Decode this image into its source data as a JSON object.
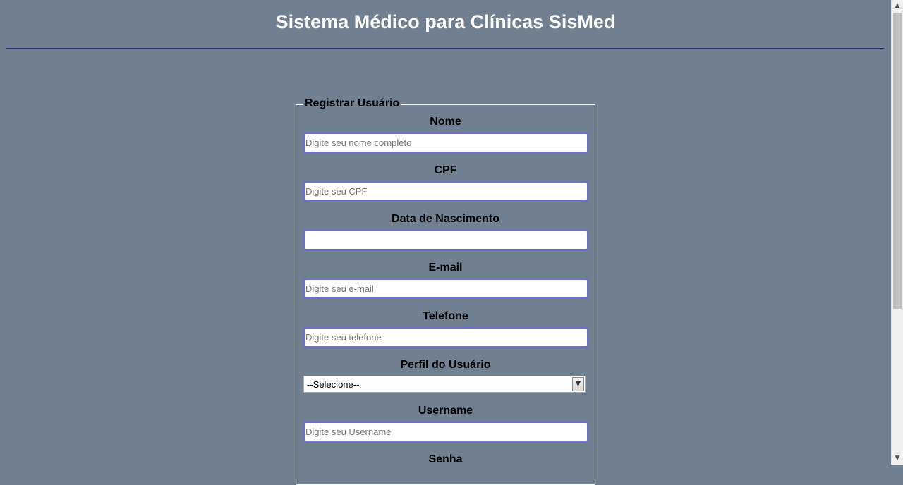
{
  "header": {
    "title": "Sistema Médico para Clínicas SisMed"
  },
  "form": {
    "legend": "Registrar Usuário",
    "fields": [
      {
        "label": "Nome",
        "placeholder": "Digite seu nome completo",
        "value": ""
      },
      {
        "label": "CPF",
        "placeholder": "Digite seu CPF",
        "value": ""
      },
      {
        "label": "Data de Nascimento",
        "placeholder": "",
        "value": ""
      },
      {
        "label": "E-mail",
        "placeholder": "Digite seu e-mail",
        "value": ""
      },
      {
        "label": "Telefone",
        "placeholder": "Digite seu telefone",
        "value": ""
      }
    ],
    "profile": {
      "label": "Perfil do Usuário",
      "selected": "--Selecione--"
    },
    "username": {
      "label": "Username",
      "placeholder": "Digite seu Username",
      "value": ""
    },
    "password": {
      "label": "Senha"
    }
  },
  "icons": {
    "select_arrow": "chevron-down-icon",
    "scroll_up": "scroll-up-arrow-icon",
    "scroll_down": "scroll-down-arrow-icon"
  },
  "colors": {
    "background": "#708090",
    "input_border": "#6c6fd0",
    "title_text": "#ffffff"
  }
}
